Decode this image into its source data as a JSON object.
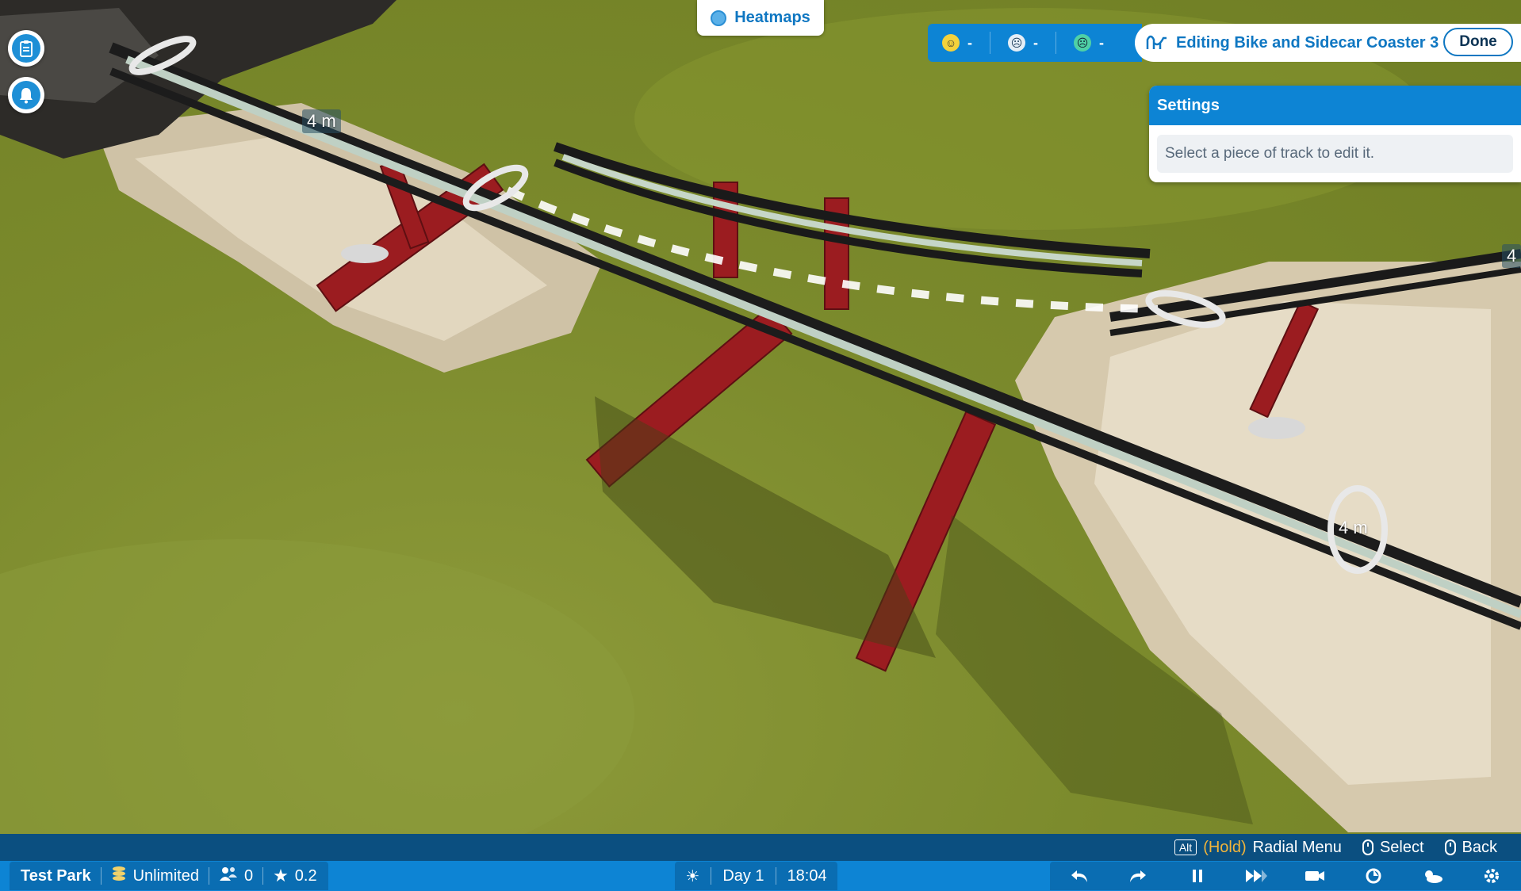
{
  "top": {
    "heatmaps_label": "Heatmaps",
    "moods": [
      {
        "icon": "happy-face-icon",
        "value": "-"
      },
      {
        "icon": "angry-face-icon",
        "value": "-"
      },
      {
        "icon": "sick-face-icon",
        "value": "-"
      }
    ],
    "editing_title": "Editing Bike and Sidecar Coaster 3",
    "done_label": "Done"
  },
  "settings": {
    "title": "Settings",
    "hint": "Select a piece of track to edit it."
  },
  "world_labels": {
    "height_a": "4 m",
    "height_b": "4 m",
    "height_c": "4"
  },
  "hints": {
    "alt_key": "Alt",
    "hold": "(Hold)",
    "radial_menu": "Radial Menu",
    "select": "Select",
    "back": "Back"
  },
  "status": {
    "park_name": "Test Park",
    "money": "Unlimited",
    "guests": "0",
    "rating": "0.2",
    "day": "Day 1",
    "time": "18:04"
  },
  "colors": {
    "accent_blue": "#0d84d4",
    "dark_blue": "#0b4f80",
    "title_blue": "#0f77c2",
    "hold_orange": "#f2b43a"
  }
}
